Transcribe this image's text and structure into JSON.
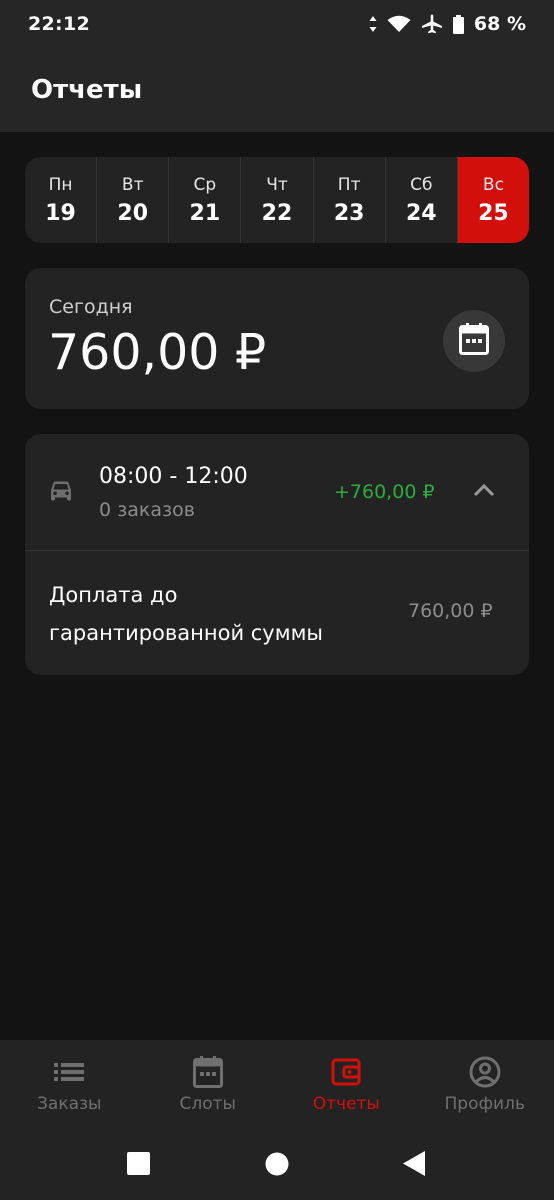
{
  "status_bar": {
    "time": "22:12",
    "battery": "68 %",
    "icons": [
      "data-arrows-icon",
      "wifi-icon",
      "airplane-icon",
      "battery-icon"
    ]
  },
  "header": {
    "title": "Отчеты"
  },
  "week": {
    "days": [
      {
        "name": "Пн",
        "num": "19"
      },
      {
        "name": "Вт",
        "num": "20"
      },
      {
        "name": "Ср",
        "num": "21"
      },
      {
        "name": "Чт",
        "num": "22"
      },
      {
        "name": "Пт",
        "num": "23"
      },
      {
        "name": "Сб",
        "num": "24"
      },
      {
        "name": "Вс",
        "num": "25"
      }
    ],
    "active_index": 6
  },
  "today": {
    "label": "Сегодня",
    "amount": "760,00 ₽",
    "icon": "calendar-icon"
  },
  "slot": {
    "time": "08:00 - 12:00",
    "orders": "0 заказов",
    "income": "+760,00 ₽",
    "icon": "car-icon",
    "bonus_label": "Доплата до гарантированной суммы",
    "bonus_amount": "760,00 ₽"
  },
  "bottom_nav": {
    "items": [
      {
        "label": "Заказы",
        "icon": "list-icon"
      },
      {
        "label": "Слоты",
        "icon": "calendar-icon"
      },
      {
        "label": "Отчеты",
        "icon": "wallet-icon"
      },
      {
        "label": "Профиль",
        "icon": "profile-icon"
      }
    ],
    "active_index": 2
  },
  "colors": {
    "accent": "#d20f0a",
    "positive": "#2dac3d",
    "background": "#131313",
    "card": "#232323"
  }
}
